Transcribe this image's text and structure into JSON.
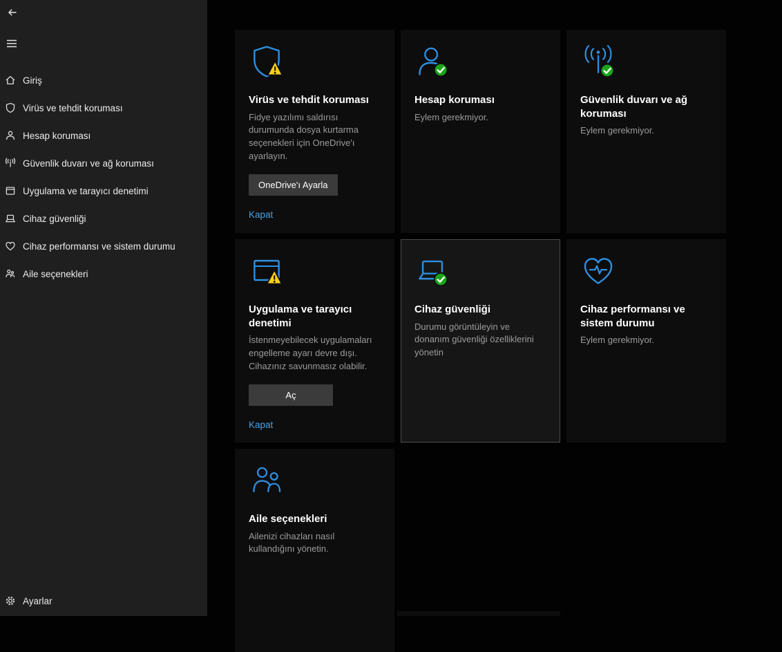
{
  "colors": {
    "accent_blue": "#2E8FE0",
    "link_blue": "#4BA0E1",
    "ok_green": "#1AA51A",
    "warn_yellow": "#FCD116",
    "sidebar_bg": "#1F1F1F",
    "tile_bg": "#0D0D0D",
    "tile_bg_highlight": "#161616"
  },
  "sidebar": {
    "items": [
      {
        "label": "Giriş",
        "icon": "home-icon"
      },
      {
        "label": "Virüs ve tehdit koruması",
        "icon": "shield-icon"
      },
      {
        "label": "Hesap koruması",
        "icon": "person-icon"
      },
      {
        "label": "Güvenlik duvarı ve ağ koruması",
        "icon": "firewall-icon"
      },
      {
        "label": "Uygulama ve tarayıcı denetimi",
        "icon": "app-browser-icon"
      },
      {
        "label": "Cihaz güvenliği",
        "icon": "device-security-icon"
      },
      {
        "label": "Cihaz performansı ve sistem durumu",
        "icon": "device-health-icon"
      },
      {
        "label": "Aile seçenekleri",
        "icon": "family-icon"
      }
    ],
    "footer_item": {
      "label": "Ayarlar",
      "icon": "gear-icon"
    }
  },
  "tiles": [
    {
      "title": "Virüs ve tehdit koruması",
      "description": "Fidye yazılımı saldırısı durumunda dosya kurtarma seçenekleri için OneDrive'ı ayarlayın.",
      "button": "OneDrive'ı Ayarla",
      "link": "Kapat",
      "icon": "shield-icon",
      "status": "warning"
    },
    {
      "title": "Hesap koruması",
      "description": "Eylem gerekmiyor.",
      "icon": "person-icon",
      "status": "ok"
    },
    {
      "title": "Güvenlik duvarı ve ağ koruması",
      "description": "Eylem gerekmiyor.",
      "icon": "firewall-icon",
      "status": "ok"
    },
    {
      "title": "Uygulama ve tarayıcı denetimi",
      "description": "İstenmeyebilecek uygulamaları engelleme ayarı devre dışı. Cihazınız savunmasız olabilir.",
      "button": "Aç",
      "link": "Kapat",
      "icon": "app-browser-icon",
      "status": "warning"
    },
    {
      "title": "Cihaz güvenliği",
      "description": "Durumu görüntüleyin ve donanım güvenliği özelliklerini yönetin",
      "icon": "device-security-icon",
      "status": "ok",
      "highlighted": true
    },
    {
      "title": "Cihaz performansı ve sistem durumu",
      "description": "Eylem gerekmiyor.",
      "icon": "device-health-icon",
      "status": "ok"
    },
    {
      "title": "Aile seçenekleri",
      "description": "Ailenizi cihazları nasıl kullandığını yönetin.",
      "icon": "family-icon",
      "status": "none"
    }
  ]
}
